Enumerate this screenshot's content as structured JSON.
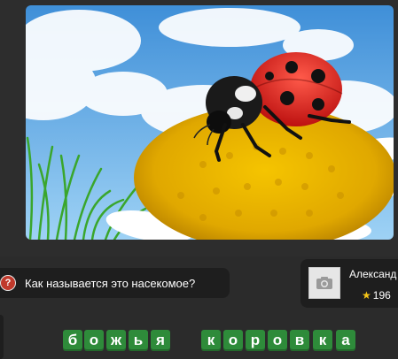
{
  "question": {
    "text": "Как называется это насекомое?",
    "icon": "question-icon",
    "icon_glyph": "?"
  },
  "player": {
    "name": "Александ",
    "score": "196",
    "star_glyph": "★"
  },
  "answer": {
    "words": [
      [
        "б",
        "о",
        "ж",
        "ь",
        "я"
      ],
      [
        "к",
        "о",
        "р",
        "о",
        "в",
        "к",
        "а"
      ]
    ]
  },
  "image": {
    "subject": "ladybug-on-daisy"
  }
}
